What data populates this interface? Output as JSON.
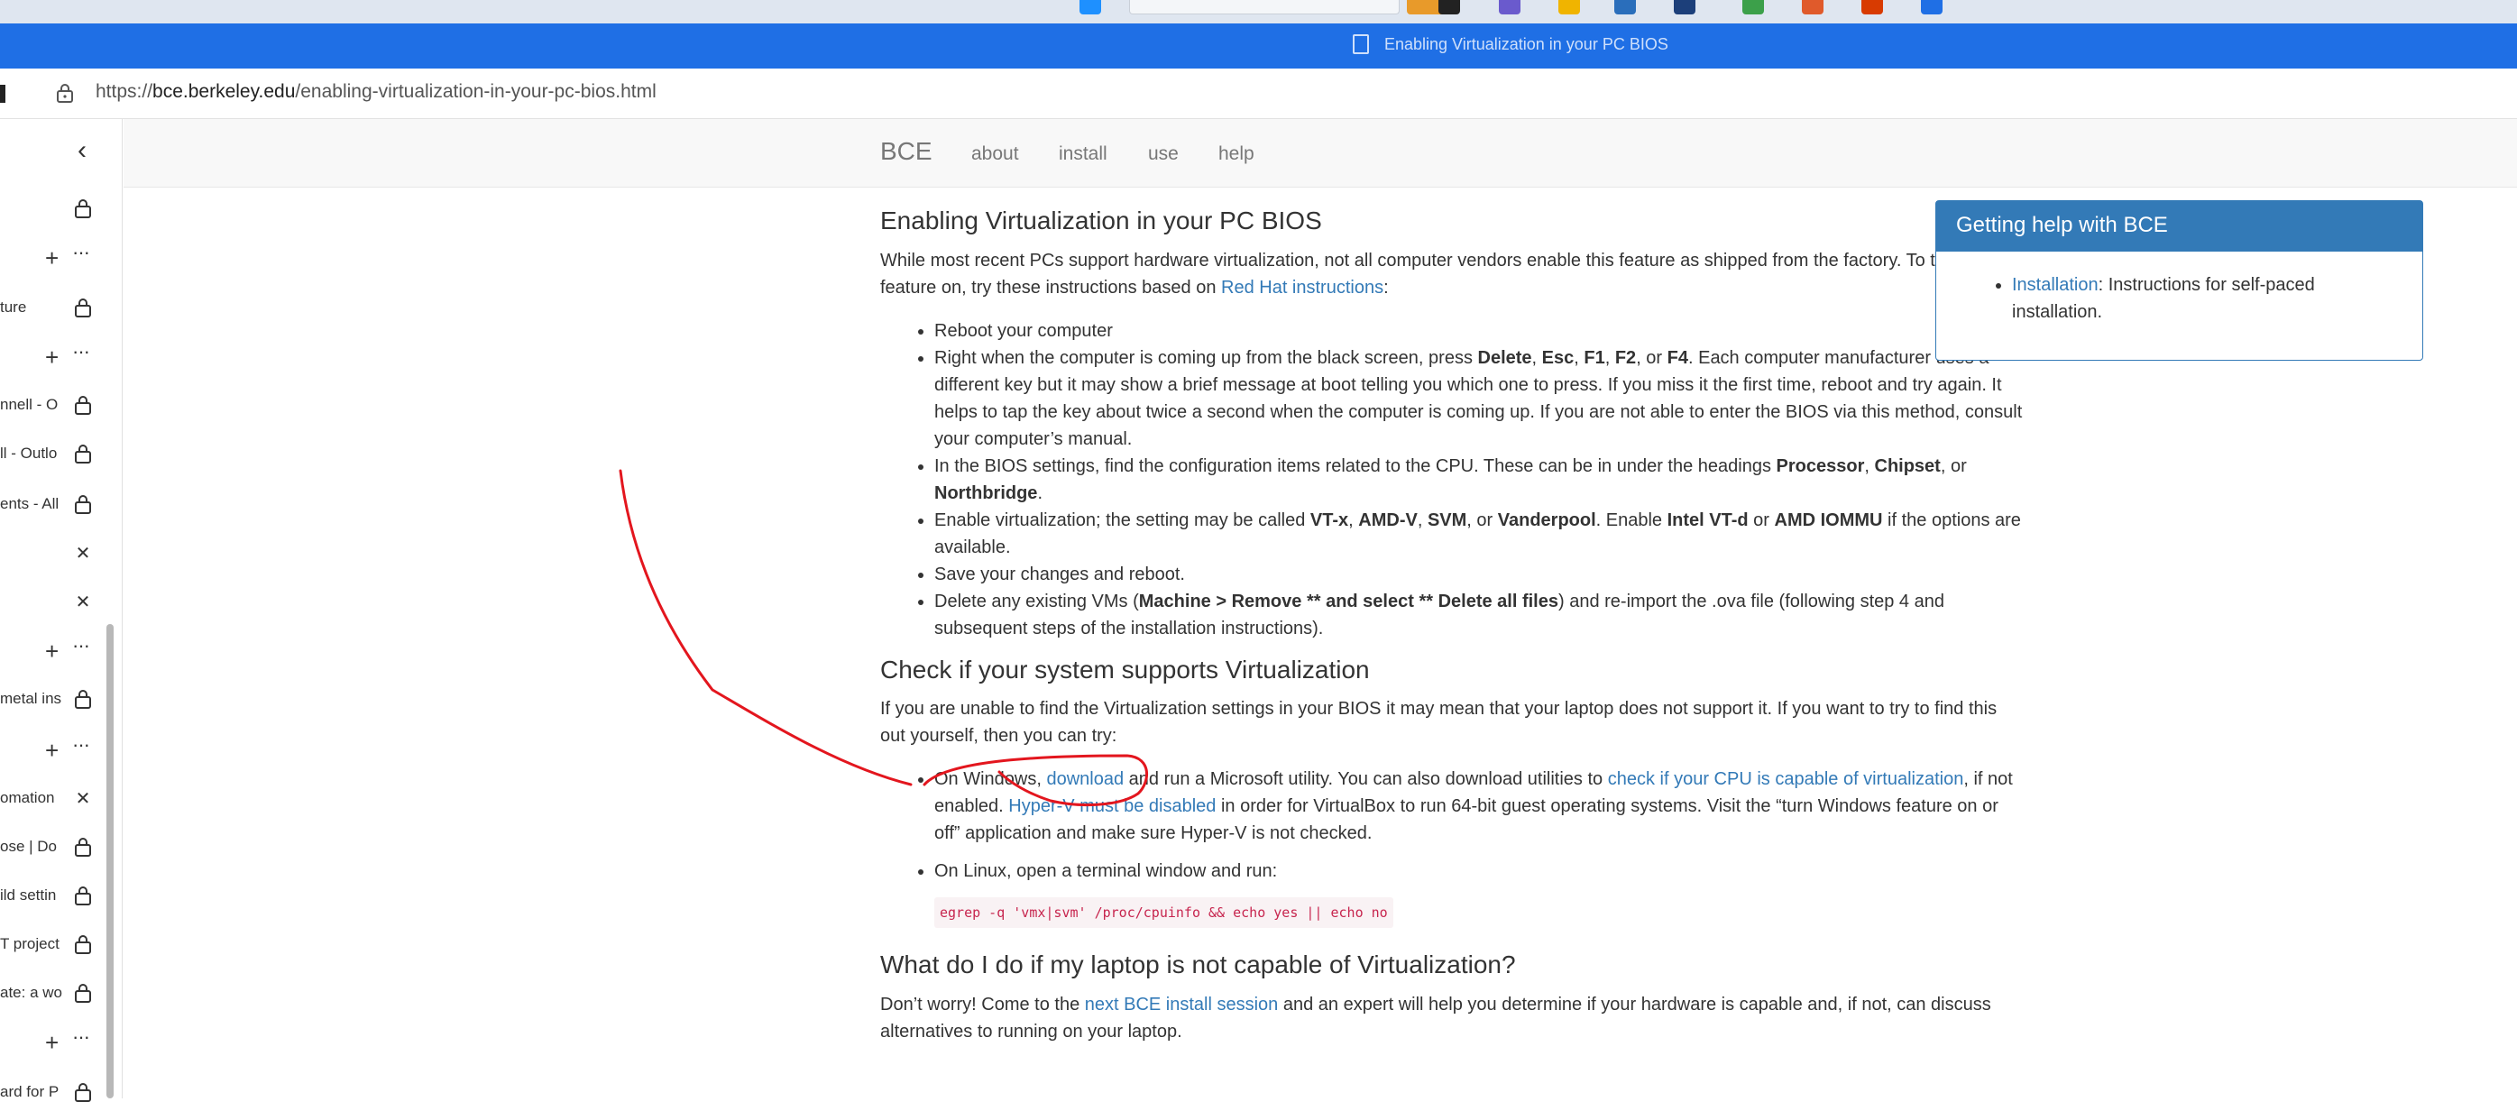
{
  "window": {
    "title": "Enabling Virtualization in your PC BIOS"
  },
  "address": {
    "scheme": "https://",
    "host": "bce.berkeley.edu",
    "path": "/enabling-virtualization-in-your-pc-bios.html"
  },
  "tabs": [
    {
      "label": "",
      "kind": "lock"
    },
    {
      "label": "",
      "kind": "group"
    },
    {
      "label": "ture",
      "kind": "lock"
    },
    {
      "label": "",
      "kind": "group"
    },
    {
      "label": "nnell - O",
      "kind": "lock"
    },
    {
      "label": "ll - Outlo",
      "kind": "lock"
    },
    {
      "label": "ents - All",
      "kind": "lock"
    },
    {
      "label": "",
      "kind": "close"
    },
    {
      "label": "",
      "kind": "close"
    },
    {
      "label": "",
      "kind": "group"
    },
    {
      "label": "metal ins",
      "kind": "lock"
    },
    {
      "label": "",
      "kind": "group"
    },
    {
      "label": "omation",
      "kind": "close"
    },
    {
      "label": "ose | Do",
      "kind": "lock"
    },
    {
      "label": "ild settin",
      "kind": "lock"
    },
    {
      "label": "T project",
      "kind": "lock"
    },
    {
      "label": "ate: a wo",
      "kind": "lock"
    },
    {
      "label": "",
      "kind": "group"
    },
    {
      "label": "ard for P",
      "kind": "lock"
    }
  ],
  "site": {
    "brand": "BCE",
    "nav": [
      "about",
      "install",
      "use",
      "help"
    ]
  },
  "article": {
    "h1": "Enabling Virtualization in your PC BIOS",
    "intro_pre": "While most recent PCs support hardware virtualization, not all computer vendors enable this feature as shipped from the factory. To turn this feature on, try these instructions based on ",
    "intro_link": "Red Hat instructions",
    "intro_post": ":",
    "steps": {
      "s1": "Reboot your computer",
      "s2_a": "Right when the computer is coming up from the black screen, press ",
      "s2_k1": "Delete",
      "s2_k2": "Esc",
      "s2_k3": "F1",
      "s2_k4": "F2",
      "s2_k5": "F4",
      "s2_b": ". Each computer manufacturer uses a different key but it may show a brief message at boot telling you which one to press. If you miss it the first time, reboot and try again. It helps to tap the key about twice a second when the computer is coming up. If you are not able to enter the BIOS via this method, consult your computer’s manual.",
      "s3_a": "In the BIOS settings, find the configuration items related to the CPU. These can be in under the headings ",
      "s3_k1": "Processor",
      "s3_k2": "Chipset",
      "s3_k3": "Northbridge",
      "s4_a": "Enable virtualization; the setting may be called ",
      "s4_k1": "VT-x",
      "s4_k2": "AMD-V",
      "s4_k3": "SVM",
      "s4_k4": "Vanderpool",
      "s4_b": ". Enable ",
      "s4_k5": "Intel VT-d",
      "s4_k6": "AMD IOMMU",
      "s4_c": " if the options are available.",
      "s5": "Save your changes and reboot.",
      "s6_a": "Delete any existing VMs (",
      "s6_k": "Machine > Remove ** and select ** Delete all files",
      "s6_b": ") and re-import the .ova file (following step 4 and subsequent steps of the installation instructions)."
    },
    "h2": "Check if your system supports Virtualization",
    "check_p": "If you are unable to find the Virtualization settings in your BIOS it may mean that your laptop does not support it. If you want to try to find this out yourself, then you can try:",
    "win_a": "On Windows, ",
    "win_link1": "download",
    "win_b": " and run a Microsoft utility. You can also download utilities to ",
    "win_link2": "check if your CPU is capable of virtualization",
    "win_c": ", if not enabled. ",
    "win_link3": "Hyper-V must be disabled",
    "win_d": " in order for VirtualBox to run 64-bit guest operating systems. Visit the “turn Windows feature on or off” application and make sure Hyper-V is not checked.",
    "linux": "On Linux, open a terminal window and run:",
    "linux_cmd": "egrep -q 'vmx|svm' /proc/cpuinfo && echo yes || echo no",
    "h3": "What do I do if my laptop is not capable of Virtualization?",
    "final_a": "Don’t worry! Come to the ",
    "final_link": "next BCE install session",
    "final_b": " and an expert will help you determine if your hardware is capable and, if not, can discuss alternatives to running on your laptop."
  },
  "panel": {
    "title": "Getting help with BCE",
    "item_link": "Installation",
    "item_text": ": Instructions for self-paced installation."
  },
  "colors": {
    "titlebar": "#1f6fe5",
    "link": "#337ab7",
    "annotation": "#e3161e"
  }
}
